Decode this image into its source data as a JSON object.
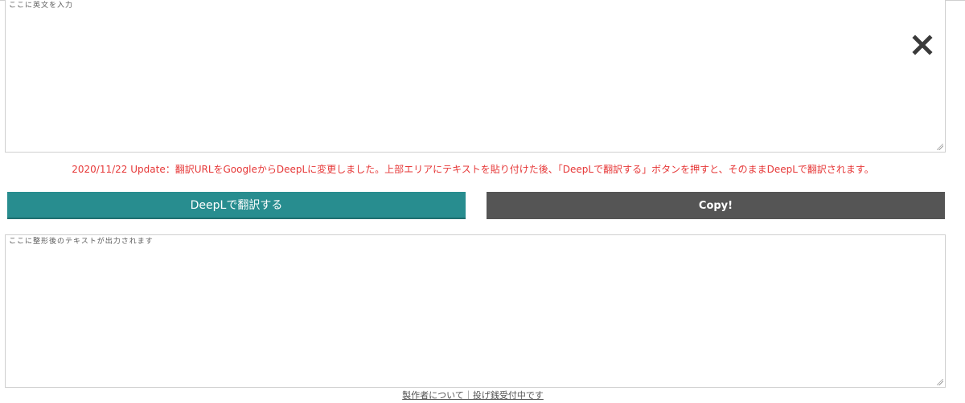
{
  "input_area": {
    "placeholder": "ここに英文を入力",
    "value": ""
  },
  "clear_icon": "close-icon",
  "notice": {
    "text": "2020/11/22 Update：翻訳URLをGoogleからDeepLに変更しました。上部エリアにテキストを貼り付けた後、「DeepLで翻訳する」ボタンを押すと、そのままDeepLで翻訳されます。"
  },
  "buttons": {
    "translate_label": "DeepLで翻訳する",
    "copy_label": "Copy!"
  },
  "output_area": {
    "placeholder": "ここに整形後のテキストが出力されます",
    "value": ""
  },
  "footer": {
    "text": "製作者について｜投げ銭受付中です"
  },
  "colors": {
    "translate_button": "#288d8f",
    "copy_button": "#555555",
    "notice_text": "#e63737",
    "border": "#cfcfcf"
  }
}
